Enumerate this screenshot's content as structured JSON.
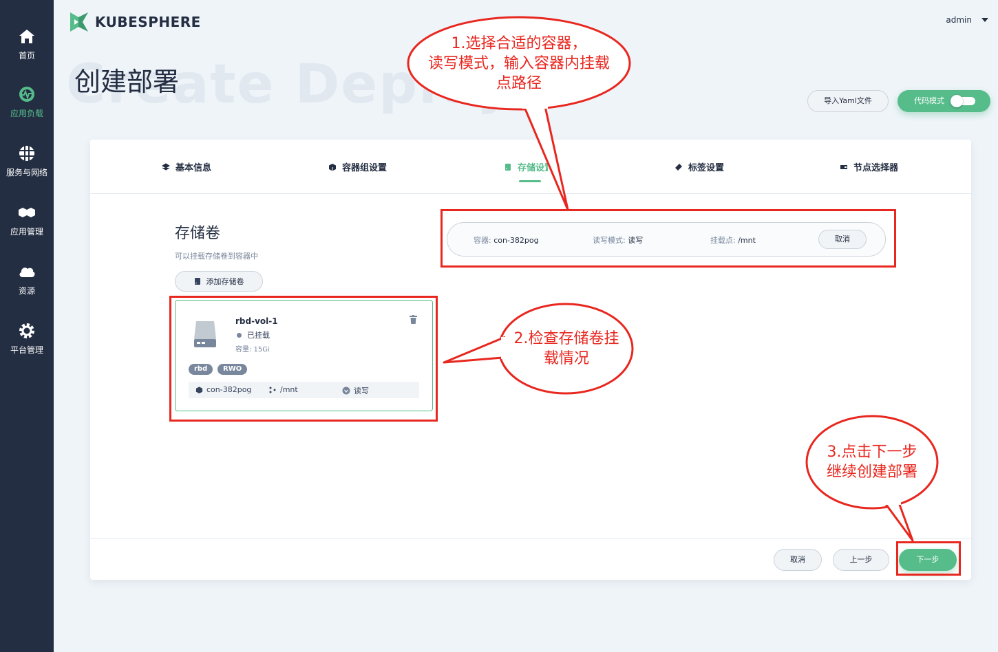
{
  "brand": {
    "name": "KUBESPHERE",
    "color": "#55bc8a"
  },
  "user": {
    "name": "admin"
  },
  "sidebar": {
    "items": [
      {
        "label": "首页",
        "icon": "home-icon"
      },
      {
        "label": "应用负载",
        "icon": "workload-icon",
        "active": true
      },
      {
        "label": "服务与网络",
        "icon": "network-icon"
      },
      {
        "label": "应用管理",
        "icon": "app-icon"
      },
      {
        "label": "资源",
        "icon": "cloud-icon"
      },
      {
        "label": "平台管理",
        "icon": "gear-icon"
      }
    ]
  },
  "page": {
    "title": "创建部署",
    "bg_title": "Create Deploym"
  },
  "header_buttons": {
    "yaml": "导入Yaml文件",
    "code_mode": "代码模式"
  },
  "tabs": [
    {
      "label": "基本信息"
    },
    {
      "label": "容器组设置"
    },
    {
      "label": "存储设置",
      "active": true
    },
    {
      "label": "标签设置"
    },
    {
      "label": "节点选择器"
    }
  ],
  "storage": {
    "title": "存储卷",
    "desc": "可以挂载存储卷到容器中",
    "add_button": "添加存储卷"
  },
  "volume": {
    "name": "rbd-vol-1",
    "status": "已挂载",
    "capacity": "容量: 15Gi",
    "tags": [
      "rbd",
      "RWO"
    ],
    "mount": {
      "container": "con-382pog",
      "path": "/mnt",
      "mode": "读写"
    }
  },
  "mount_bar": {
    "container_label": "容器: ",
    "container_value": "con-382pog",
    "mode_label": "读写模式: ",
    "mode_value": "读写",
    "point_label": "挂载点: ",
    "point_value": "/mnt",
    "cancel": "取消"
  },
  "footer": {
    "cancel": "取消",
    "prev": "上一步",
    "next": "下一步"
  },
  "annotations": {
    "a1": {
      "line1": "1.选择合适的容器，",
      "line2": "读写模式，输入容器内挂载",
      "line3": "点路径"
    },
    "a2": {
      "line1": "2.检查存储卷挂",
      "line2": "载情况"
    },
    "a3": {
      "line1": "3.点击下一步",
      "line2": "继续创建部署"
    },
    "color": "#e8271f"
  }
}
